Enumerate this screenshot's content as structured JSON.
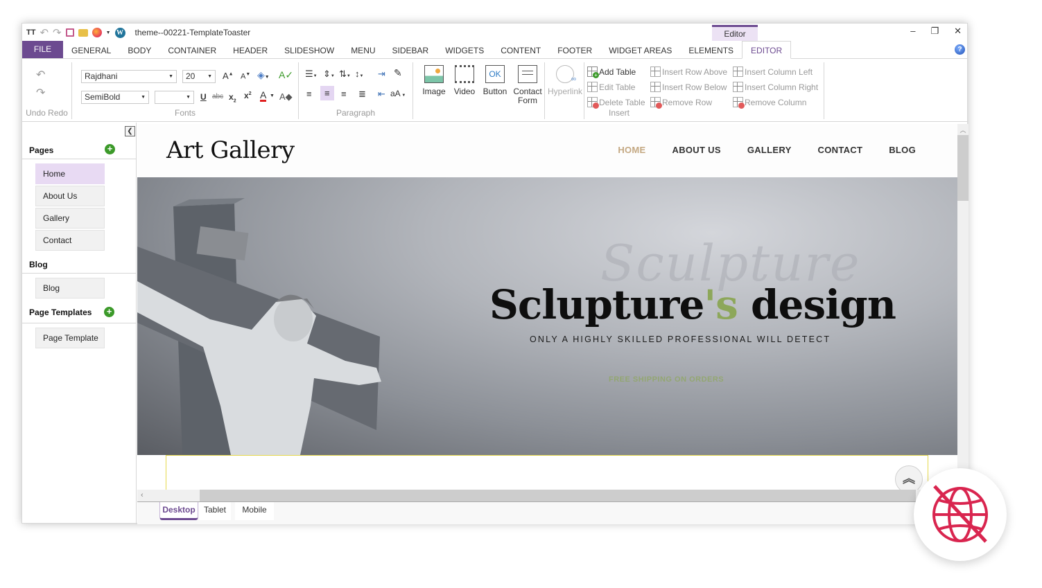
{
  "window": {
    "title": "theme--00221-TemplateToaster",
    "context_tab": "Editor",
    "controls": {
      "minimize": "‒",
      "restore": "❐",
      "close": "✕"
    }
  },
  "quick_access": [
    "text-size-icon",
    "undo-icon",
    "redo-icon",
    "save-icon",
    "open-folder-icon",
    "firefox-icon",
    "wordpress-icon"
  ],
  "tabs": [
    {
      "label": "FILE"
    },
    {
      "label": "GENERAL"
    },
    {
      "label": "BODY"
    },
    {
      "label": "CONTAINER"
    },
    {
      "label": "HEADER"
    },
    {
      "label": "SLIDESHOW"
    },
    {
      "label": "MENU"
    },
    {
      "label": "SIDEBAR"
    },
    {
      "label": "WIDGETS"
    },
    {
      "label": "CONTENT"
    },
    {
      "label": "FOOTER"
    },
    {
      "label": "WIDGET AREAS"
    },
    {
      "label": "ELEMENTS"
    },
    {
      "label": "EDITOR"
    }
  ],
  "ribbon": {
    "undo_redo_label": "Undo Redo",
    "fonts": {
      "label": "Fonts",
      "font_family": "Rajdhani",
      "font_size": "20",
      "font_weight": "SemiBold",
      "letter_spacing": ""
    },
    "paragraph": {
      "label": "Paragraph",
      "case_label": "aA"
    },
    "media": {
      "image": "Image",
      "video": "Video",
      "button": "Button",
      "button_glyph": "OK",
      "contact_form_1": "Contact",
      "contact_form_2": "Form",
      "hyperlink": "Hyperlink"
    },
    "insert": {
      "label": "Insert",
      "add_table": "Add Table",
      "edit_table": "Edit Table",
      "delete_table": "Delete Table",
      "insert_row_above": "Insert Row Above",
      "insert_row_below": "Insert Row Below",
      "remove_row": "Remove Row",
      "insert_column_left": "Insert Column Left",
      "insert_column_right": "Insert Column Right",
      "remove_column": "Remove Column"
    }
  },
  "sidebar": {
    "pages_title": "Pages",
    "pages": [
      "Home",
      "About Us",
      "Gallery",
      "Contact"
    ],
    "selected_page": "Home",
    "blog_title": "Blog",
    "blog_items": [
      "Blog"
    ],
    "templates_title": "Page Templates",
    "template_items": [
      "Page Template"
    ]
  },
  "site": {
    "logo": "Art Gallery",
    "nav": [
      "HOME",
      "ABOUT US",
      "GALLERY",
      "CONTACT",
      "BLOG"
    ],
    "nav_active": "HOME",
    "hero": {
      "script_word": "Sculpture",
      "title_part1": "Sclupture",
      "title_accent": "'s",
      "title_part2": " design",
      "subtitle": "ONLY A HIGHLY SKILLED PROFESSIONAL WILL DETECT",
      "shipping": "FREE SHIPPING ON ORDERS"
    },
    "colors": {
      "nav_active": "#c4a882",
      "accent": "#8da75a"
    }
  },
  "devices": {
    "tabs": [
      "Desktop",
      "Tablet",
      "Mobile"
    ],
    "active": "Desktop"
  },
  "colors": {
    "brand": "#6c4a90",
    "offline": "#d9254f",
    "add": "#3c9a2a"
  }
}
